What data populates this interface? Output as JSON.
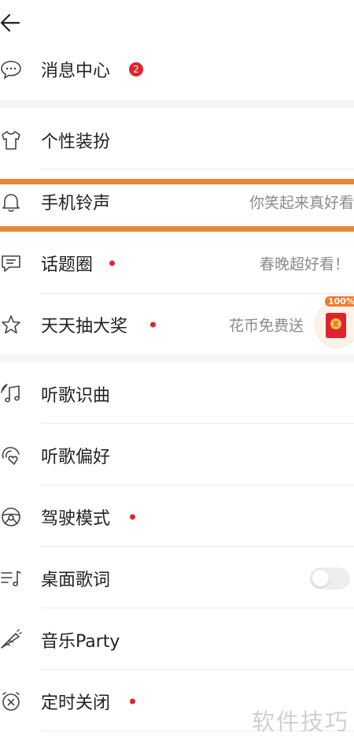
{
  "colors": {
    "accent_red": "#e0242f",
    "highlight_orange": "#e8873a",
    "text_primary": "#222222",
    "text_secondary": "#8a8a8a"
  },
  "header": {
    "back_icon": "back-arrow-icon"
  },
  "items": [
    {
      "id": "messages",
      "label": "消息中心",
      "icon": "chat-bubble-icon",
      "badge": "2"
    },
    {
      "id": "skin",
      "label": "个性装扮",
      "icon": "tshirt-icon"
    },
    {
      "id": "ringtone",
      "label": "手机铃声",
      "icon": "bell-icon",
      "right_text": "你笑起来真好看"
    },
    {
      "id": "topics",
      "label": "话题圈",
      "icon": "comment-icon",
      "red_dot": true,
      "right_text": "春晚超好看！"
    },
    {
      "id": "lottery",
      "label": "天天抽大奖",
      "icon": "star-icon",
      "red_dot": true,
      "right_text": "花币免费送",
      "promo_tag": "100%",
      "promo_seal": "奖"
    },
    {
      "id": "recognize",
      "label": "听歌识曲",
      "icon": "music-note-icon"
    },
    {
      "id": "preferences",
      "label": "听歌偏好",
      "icon": "heart-rings-icon"
    },
    {
      "id": "driving",
      "label": "驾驶模式",
      "icon": "steering-wheel-icon",
      "red_dot": true
    },
    {
      "id": "desktop_lyrics",
      "label": "桌面歌词",
      "icon": "lyrics-icon",
      "toggle": "off"
    },
    {
      "id": "party",
      "label": "音乐Party",
      "icon": "party-horn-icon"
    },
    {
      "id": "timer",
      "label": "定时关闭",
      "icon": "close-circle-icon",
      "red_dot": true
    }
  ],
  "watermark": "软件技巧"
}
